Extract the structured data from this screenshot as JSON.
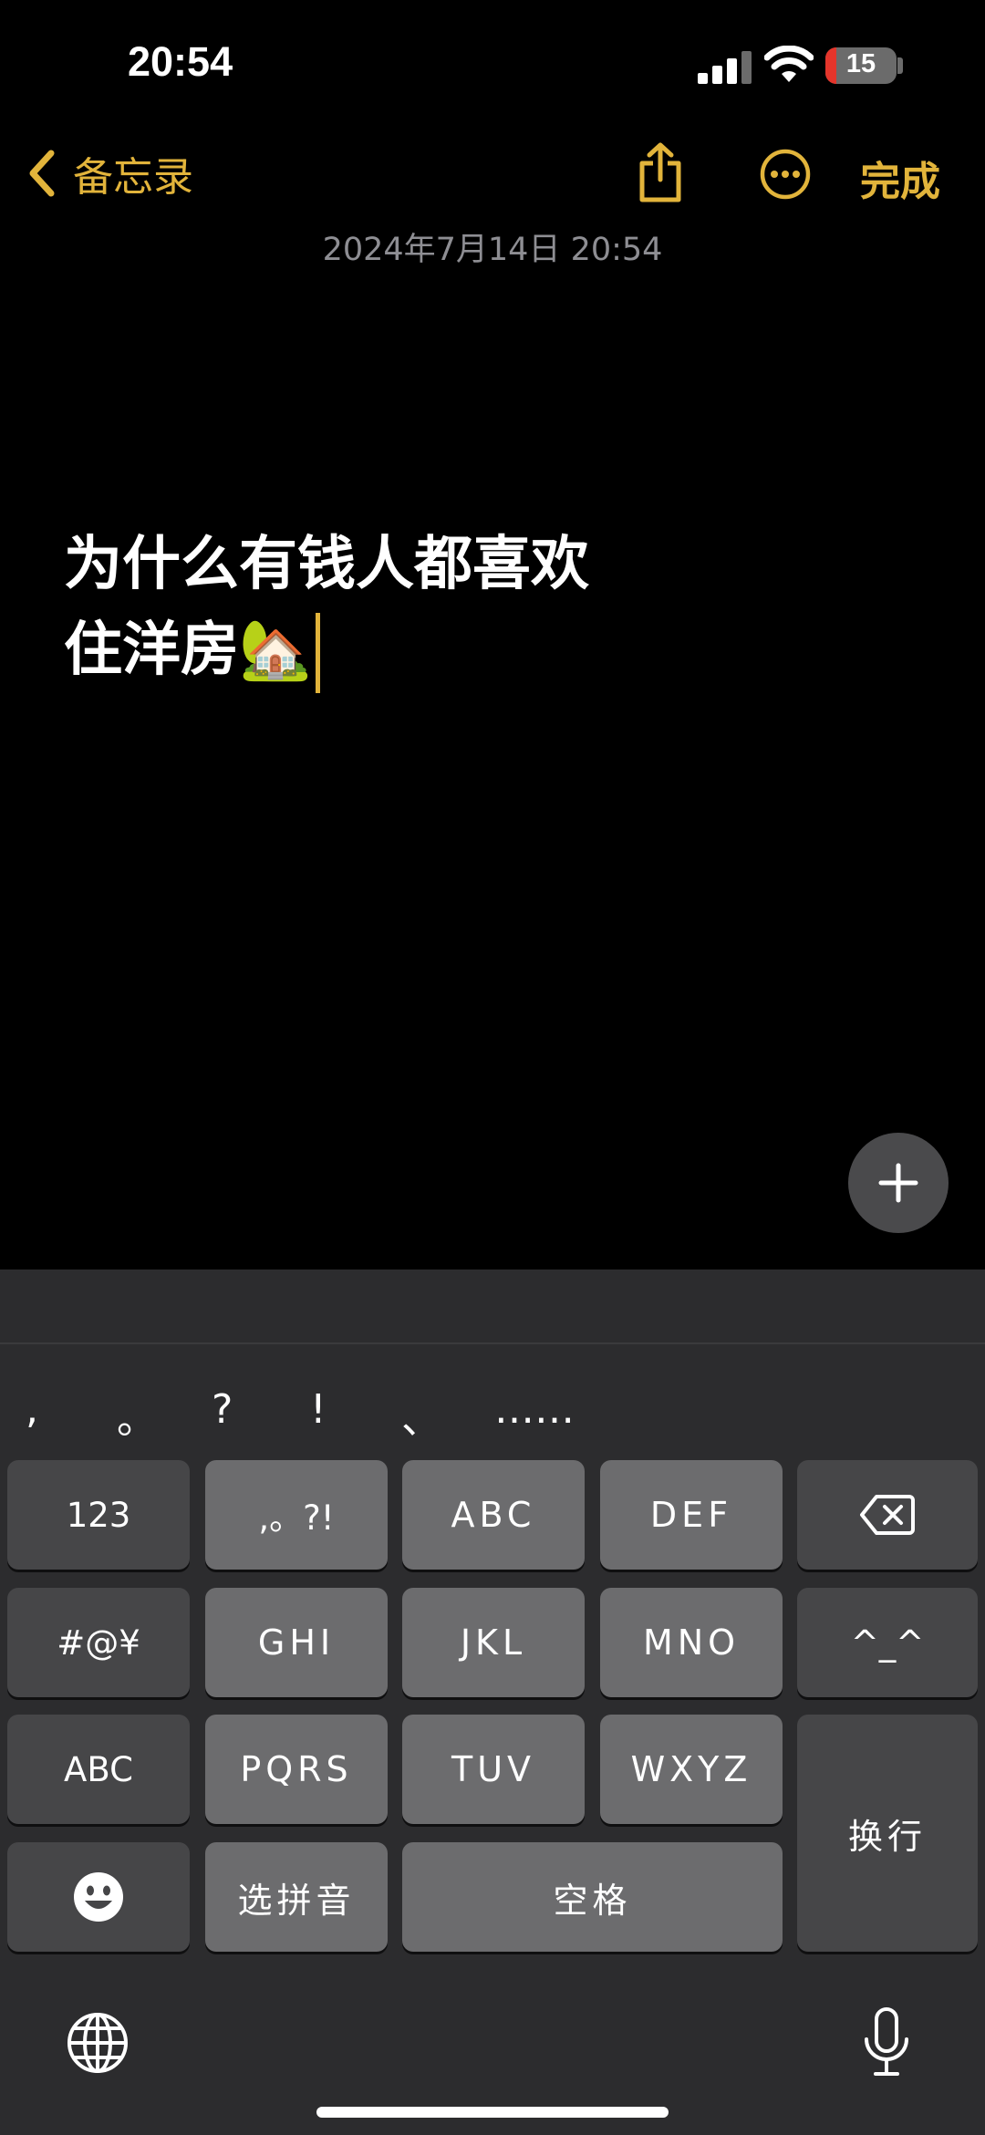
{
  "status_bar": {
    "time": "20:54",
    "battery_level": "15",
    "battery_fraction": 0.15,
    "battery_color": "#e5352b"
  },
  "nav": {
    "back_label": "备忘录",
    "done_label": "完成",
    "accent": "#e2b43b"
  },
  "note": {
    "date": "2024年7月14日 20:54",
    "line1": "为什么有钱人都喜欢",
    "line2": "住洋房",
    "emoji": "🏡"
  },
  "candidates": [
    ",",
    "。",
    "?",
    "!",
    "、",
    "……"
  ],
  "keys": {
    "num": "123",
    "punct": ",。?!",
    "abc_t9": "ABC",
    "def": "DEF",
    "symbols": "#@¥",
    "ghi": "GHI",
    "jkl": "JKL",
    "mno": "MNO",
    "emoticon": "^_^",
    "abc_switch": "ABC",
    "pqrs": "PQRS",
    "tuv": "TUV",
    "wxyz": "WXYZ",
    "return": "换行",
    "pinyin": "选拼音",
    "space": "空格"
  },
  "icons": [
    "chevron-left-icon",
    "share-icon",
    "more-icon",
    "plus-icon",
    "backspace-icon",
    "emoji-icon",
    "globe-icon",
    "microphone-icon"
  ]
}
